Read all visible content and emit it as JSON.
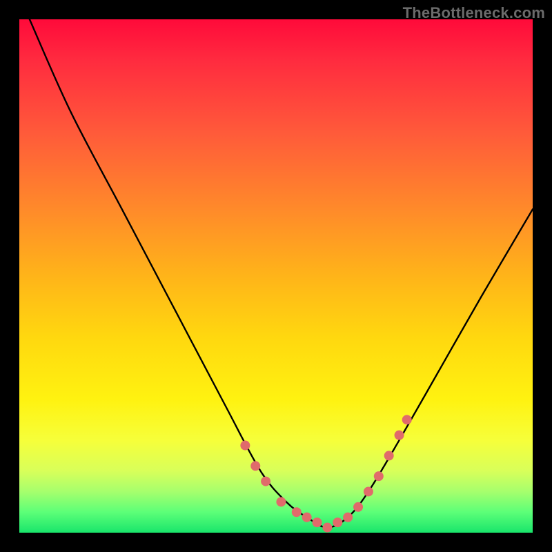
{
  "watermark": {
    "text": "TheBottleneck.com"
  },
  "chart_data": {
    "type": "line",
    "title": "",
    "xlabel": "",
    "ylabel": "",
    "xlim": [
      0,
      100
    ],
    "ylim": [
      0,
      100
    ],
    "grid": false,
    "legend": false,
    "series": [
      {
        "name": "bottleneck-curve",
        "color": "#000000",
        "x": [
          2,
          10,
          20,
          30,
          40,
          47,
          52,
          56,
          60,
          64,
          68,
          74,
          82,
          90,
          100
        ],
        "y": [
          100,
          82,
          63,
          44,
          25,
          12,
          6,
          3,
          1,
          3,
          8,
          18,
          32,
          46,
          63
        ]
      }
    ],
    "markers": [
      {
        "name": "highlight-dots",
        "color": "#e06b6b",
        "radius_px": 7,
        "x": [
          44,
          46,
          48,
          51,
          54,
          56,
          58,
          60,
          62,
          64,
          66,
          68,
          70,
          72,
          74,
          75.5
        ],
        "y": [
          17,
          13,
          10,
          6,
          4,
          3,
          2,
          1,
          2,
          3,
          5,
          8,
          11,
          15,
          19,
          22
        ]
      }
    ],
    "annotations": []
  }
}
